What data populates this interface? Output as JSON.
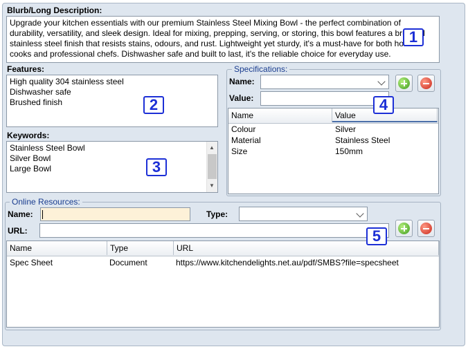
{
  "blurb": {
    "label": "Blurb/Long Description:",
    "text": "Upgrade your kitchen essentials with our premium Stainless Steel Mixing Bowl - the perfect combination of durability, versatility, and sleek design. Ideal for mixing, prepping, serving, or storing, this bowl features a brushed stainless steel finish that resists stains, odours, and rust. Lightweight yet sturdy, it's a must-have for both home cooks and professional chefs. Dishwasher safe and built to last, it's the reliable choice for everyday use."
  },
  "features": {
    "label": "Features:",
    "items": [
      "High quality 304 stainless steel",
      "Dishwasher safe",
      "Brushed finish"
    ]
  },
  "keywords": {
    "label": "Keywords:",
    "items": [
      "Stainless Steel Bowl",
      "Silver Bowl",
      "Large Bowl"
    ]
  },
  "specifications": {
    "title": "Specifications:",
    "name_label": "Name:",
    "value_label": "Value:",
    "name_value": "",
    "value_value": "",
    "columns": [
      "Name",
      "Value"
    ],
    "rows": [
      {
        "name": "Colour",
        "value": "Silver"
      },
      {
        "name": "Material",
        "value": "Stainless Steel"
      },
      {
        "name": "Size",
        "value": "150mm"
      }
    ]
  },
  "online_resources": {
    "title": "Online Resources:",
    "name_label": "Name:",
    "type_label": "Type:",
    "url_label": "URL:",
    "name_value": "",
    "url_value": "",
    "type_value": "",
    "columns": [
      "Name",
      "Type",
      "URL"
    ],
    "rows": [
      {
        "name": "Spec Sheet",
        "type": "Document",
        "url": "https://www.kitchendelights.net.au/pdf/SMBS?file=specsheet"
      }
    ]
  },
  "markers": [
    "1",
    "2",
    "3",
    "4",
    "5"
  ],
  "icons": {
    "add": "add-icon",
    "remove": "remove-icon"
  },
  "colors": {
    "panel_bg": "#dee6ef",
    "group_title": "#1a3d8f",
    "marker": "#1c2fd6",
    "name_input_bg": "#fdf1d8"
  }
}
